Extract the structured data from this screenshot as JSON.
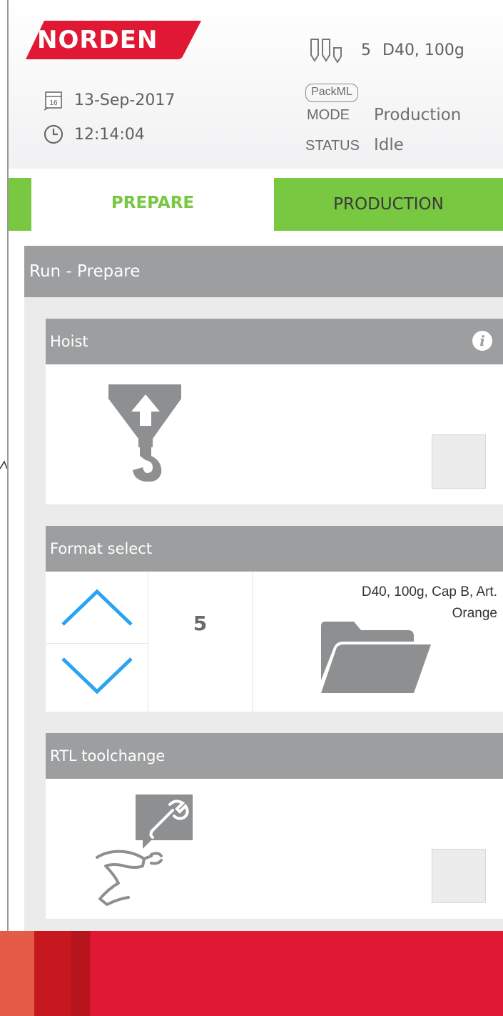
{
  "header": {
    "brand": "NORDEN",
    "date": "13-Sep-2017",
    "calendar_day": "16",
    "time": "12:14:04",
    "format_number": "5",
    "format_short": "D40, 100g",
    "packml_badge": "PackML",
    "mode_label": "MODE",
    "mode_value": "Production",
    "status_label": "STATUS",
    "status_value": "Idle"
  },
  "tabs": [
    {
      "label": "PREPARE",
      "active": true
    },
    {
      "label": "PRODUCTION",
      "active": false
    }
  ],
  "run_panel": {
    "title": "Run - Prepare",
    "cards": {
      "hoist": {
        "title": "Hoist",
        "info_icon": "i"
      },
      "format_select": {
        "title": "Format select",
        "number": "5",
        "description_line1": "D40, 100g, Cap B, Art.",
        "description_line2": "Orange"
      },
      "rtl_toolchange": {
        "title": "RTL toolchange"
      }
    }
  },
  "colors": {
    "brand_red": "#e11833",
    "accent_green": "#78c842",
    "header_gray": "#9d9e9f",
    "arrow_blue": "#2aa3f0"
  },
  "icons": [
    "norden-logo",
    "calendar-icon",
    "clock-icon",
    "bottles-icon",
    "info-icon",
    "hoist-icon",
    "arrow-up-icon",
    "arrow-down-icon",
    "folder-open-icon",
    "robot-wrench-icon"
  ]
}
